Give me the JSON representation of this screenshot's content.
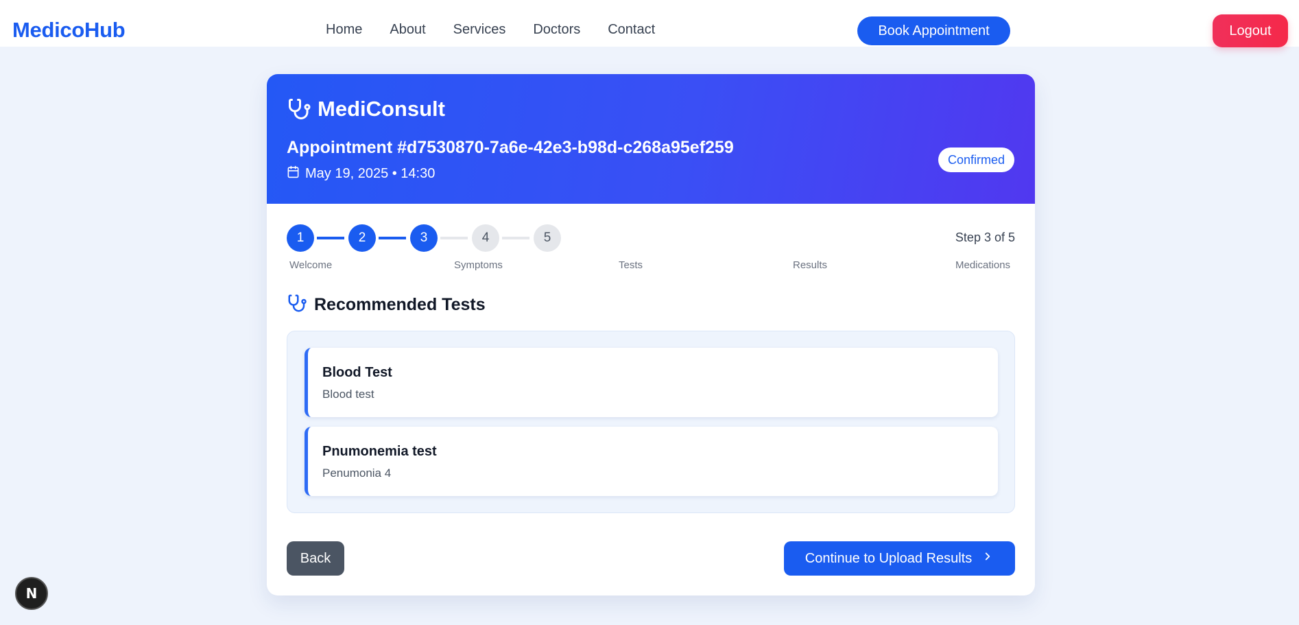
{
  "nav": {
    "brand": "MedicoHub",
    "links": [
      "Home",
      "About",
      "Services",
      "Doctors",
      "Contact"
    ],
    "book_label": "Book Appointment",
    "logout_label": "Logout"
  },
  "card": {
    "app_name": "MediConsult",
    "appointment_title": "Appointment #d7530870-7a6e-42e3-b98d-c268a95ef259",
    "appointment_datetime": "May 19, 2025 • 14:30",
    "status": "Confirmed"
  },
  "stepper": {
    "steps": [
      "1",
      "2",
      "3",
      "4",
      "5"
    ],
    "completed_steps": 3,
    "labels": [
      "Welcome",
      "Symptoms",
      "Tests",
      "Results",
      "Medications"
    ],
    "counter": "Step 3 of 5"
  },
  "section": {
    "title": "Recommended Tests"
  },
  "tests": [
    {
      "name": "Blood Test",
      "description": "Blood test"
    },
    {
      "name": "Pnumonemia test",
      "description": "Penumonia 4"
    }
  ],
  "actions": {
    "back_label": "Back",
    "continue_label": "Continue to Upload Results"
  },
  "dev_badge": "N",
  "colors": {
    "primary": "#1a5cf0",
    "header_gradient_end": "#5138f0",
    "logout": "#f0305a",
    "back": "#4b5563"
  }
}
